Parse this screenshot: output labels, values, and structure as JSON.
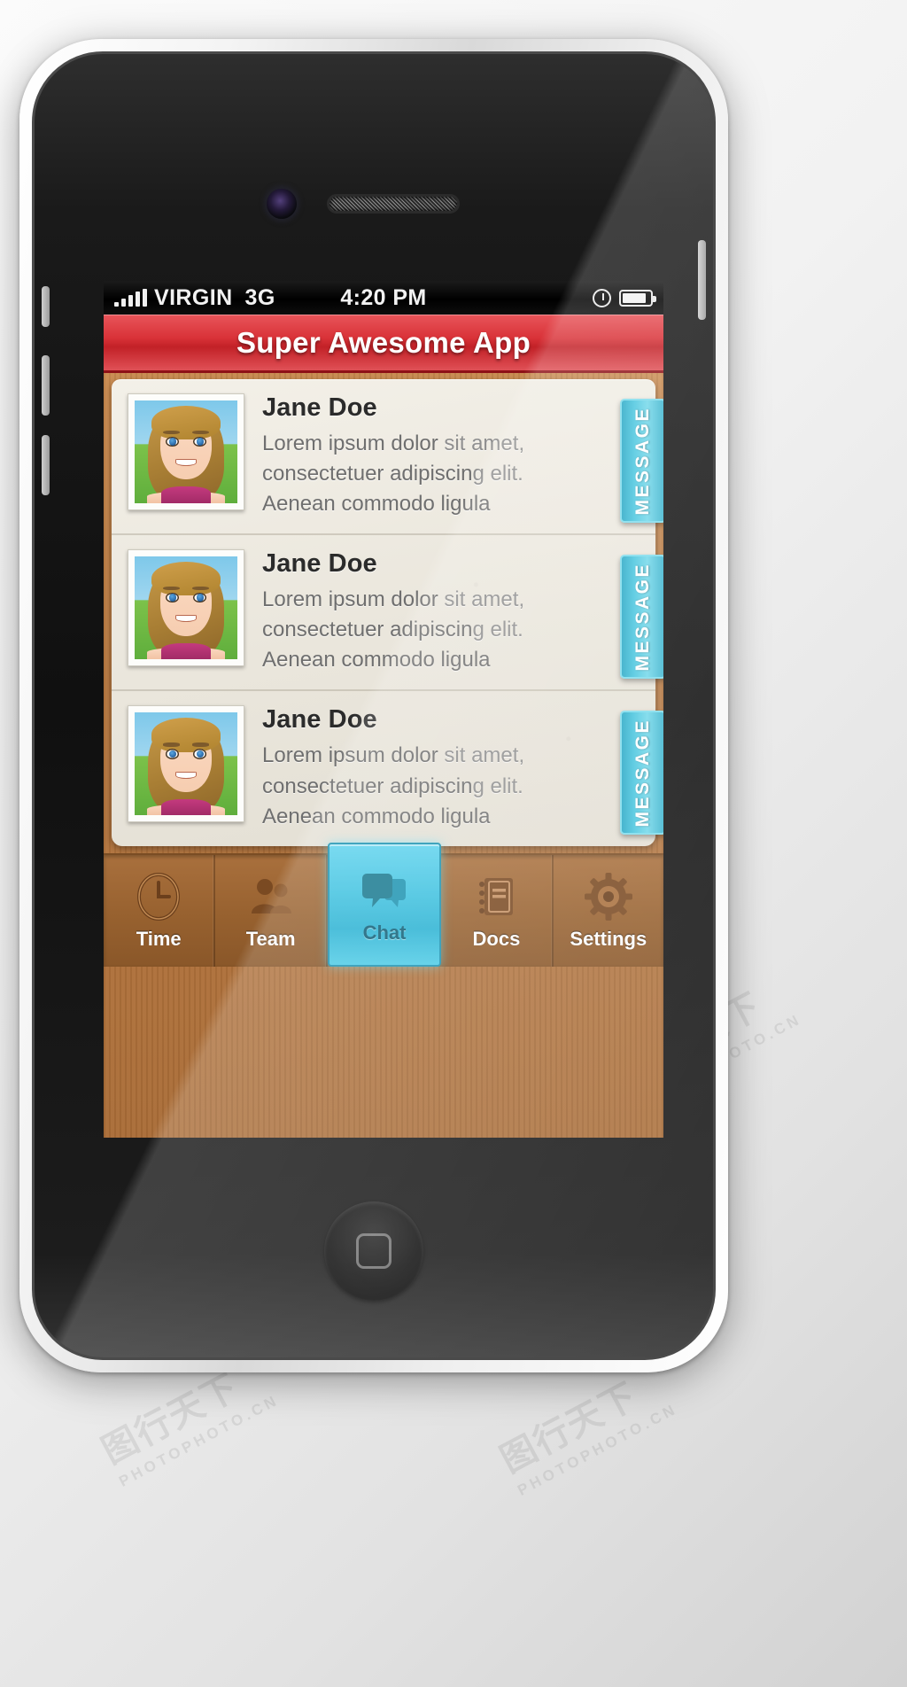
{
  "statusbar": {
    "carrier": "VIRGIN",
    "network": "3G",
    "time": "4:20 PM",
    "signal_icon": "signal-bars-icon",
    "alarm_icon": "clock-icon",
    "battery_icon": "battery-icon"
  },
  "header": {
    "title": "Super Awesome App",
    "accent_color": "#d93238"
  },
  "list": {
    "items": [
      {
        "name": "Jane Doe",
        "desc_line1": "Lorem ipsum dolor",
        "desc_line1b": " sit amet,",
        "desc_line2": "consectetuer adipiscin",
        "desc_line2b": "g elit.",
        "desc_line3": "Aenean commodo ligula",
        "action_label": "MESSAGE",
        "avatar_alt": "jane-doe-avatar"
      },
      {
        "name": "Jane Doe",
        "desc_line1": "Lorem ipsum dolor",
        "desc_line1b": " sit amet,",
        "desc_line2": "consectetuer adipiscin",
        "desc_line2b": "g elit.",
        "desc_line3": "Aenean commodo ligula",
        "action_label": "MESSAGE",
        "avatar_alt": "jane-doe-avatar"
      },
      {
        "name": "Jane Doe",
        "desc_line1": "Lorem ipsum dolor",
        "desc_line1b": " sit amet,",
        "desc_line2": "consectetuer adipiscin",
        "desc_line2b": "g elit.",
        "desc_line3": "Aenean commodo ligula",
        "action_label": "MESSAGE",
        "avatar_alt": "jane-doe-avatar"
      }
    ]
  },
  "tabbar": {
    "active_index": 2,
    "active_color": "#3fc2e0",
    "items": [
      {
        "label": "Time",
        "icon": "clock-icon"
      },
      {
        "label": "Team",
        "icon": "people-icon"
      },
      {
        "label": "Chat",
        "icon": "chat-bubbles-icon"
      },
      {
        "label": "Docs",
        "icon": "notebook-icon"
      },
      {
        "label": "Settings",
        "icon": "gear-icon"
      }
    ]
  },
  "watermark": {
    "big": "图行天下",
    "sub": "PHOTOPHOTO.CN"
  }
}
